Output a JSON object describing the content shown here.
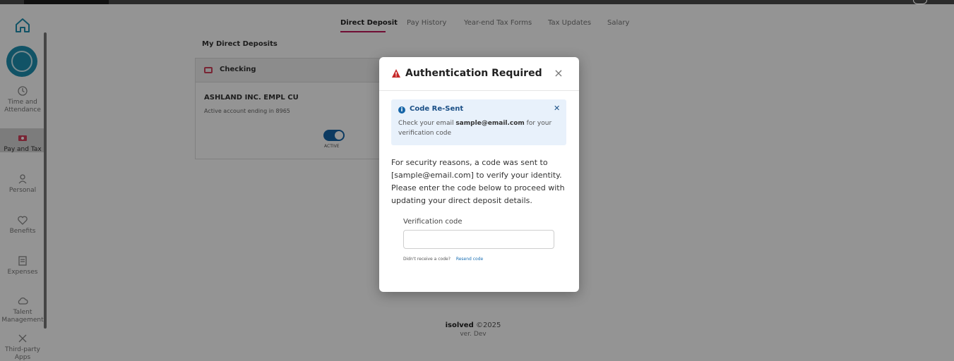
{
  "nav": {
    "items": [
      {
        "label": "Time and Attendance",
        "icon": "clock-icon"
      },
      {
        "label": "Pay and Tax",
        "icon": "money-icon"
      },
      {
        "label": "Personal",
        "icon": "person-icon"
      },
      {
        "label": "Benefits",
        "icon": "heart-icon"
      },
      {
        "label": "Expenses",
        "icon": "receipt-icon"
      },
      {
        "label": "Talent Management",
        "icon": "cloud-icon"
      },
      {
        "label": "Third-party Apps",
        "icon": "tools-icon"
      }
    ]
  },
  "tabs": [
    "Direct Deposit",
    "Pay History",
    "Year-end Tax Forms",
    "Tax Updates",
    "Salary"
  ],
  "active_tab": "Direct Deposit",
  "main": {
    "section_title": "My Direct Deposits",
    "card": {
      "type": "Checking",
      "account_name": "ASHLAND INC. EMPL CU",
      "account_sub": "Active account ending in 8965",
      "toggle_label": "ACTIVE",
      "toggle_on": true
    }
  },
  "footer": {
    "brand": "isolved",
    "copyright": "©2025",
    "version": "ver. Dev"
  },
  "modal": {
    "title": "Authentication Required",
    "alert": {
      "title": "Code Re-Sent",
      "body_prefix": "Check your email ",
      "email": "sample@email.com",
      "body_suffix": " for your verification code"
    },
    "message": "For security reasons, a code was sent to [sample@email.com] to verify your identity. Please enter the code below to proceed with updating your direct deposit details.",
    "field_label": "Verification code",
    "field_value": "",
    "field_placeholder": "",
    "resend_prompt": "Didn't receive a code?",
    "resend_link": "Resend code"
  },
  "colors": {
    "accent": "#c2185b",
    "primary": "#1565a8",
    "brand": "#1e8fb0",
    "warning": "#c62828"
  }
}
